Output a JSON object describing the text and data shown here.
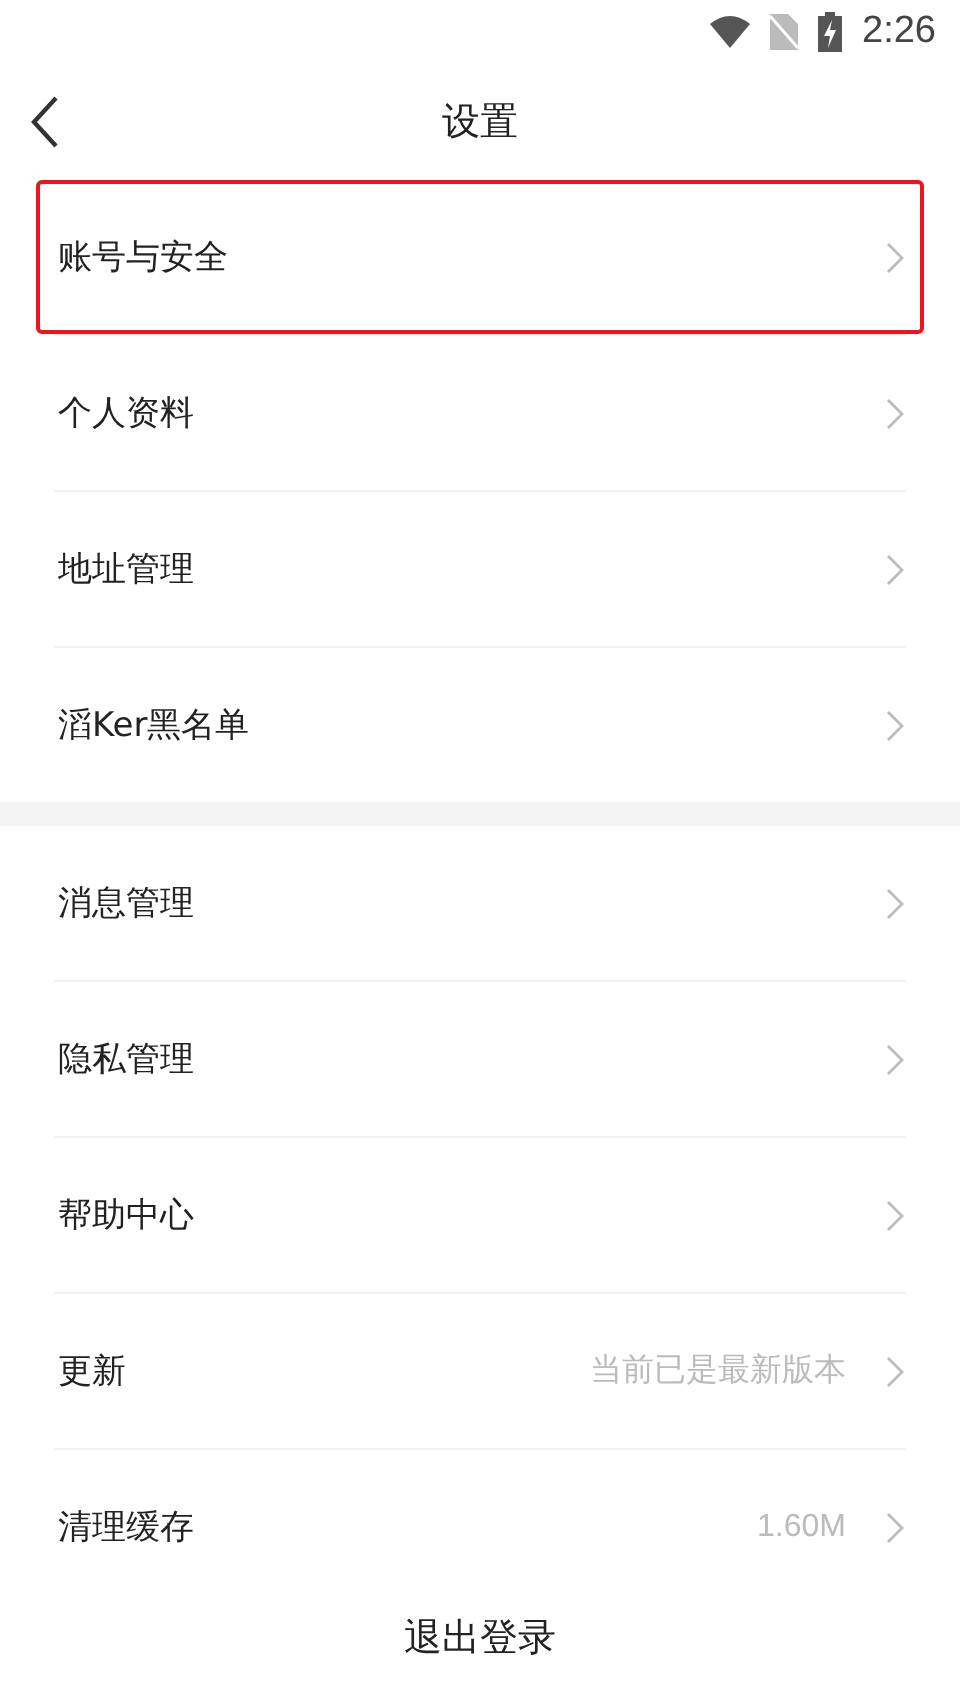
{
  "status_bar": {
    "time": "2:26"
  },
  "header": {
    "title": "设置"
  },
  "sections": [
    {
      "items": [
        {
          "label": "账号与安全",
          "highlighted": true
        },
        {
          "label": "个人资料",
          "highlighted": false
        },
        {
          "label": "地址管理",
          "highlighted": false
        },
        {
          "label": "滔Ker黑名单",
          "highlighted": false
        }
      ]
    },
    {
      "items": [
        {
          "label": "消息管理",
          "highlighted": false
        },
        {
          "label": "隐私管理",
          "highlighted": false
        },
        {
          "label": "帮助中心",
          "highlighted": false
        },
        {
          "label": "更新",
          "value": "当前已是最新版本",
          "highlighted": false
        },
        {
          "label": "清理缓存",
          "value": "1.60M",
          "highlighted": false
        }
      ]
    }
  ],
  "logout": "退出登录"
}
